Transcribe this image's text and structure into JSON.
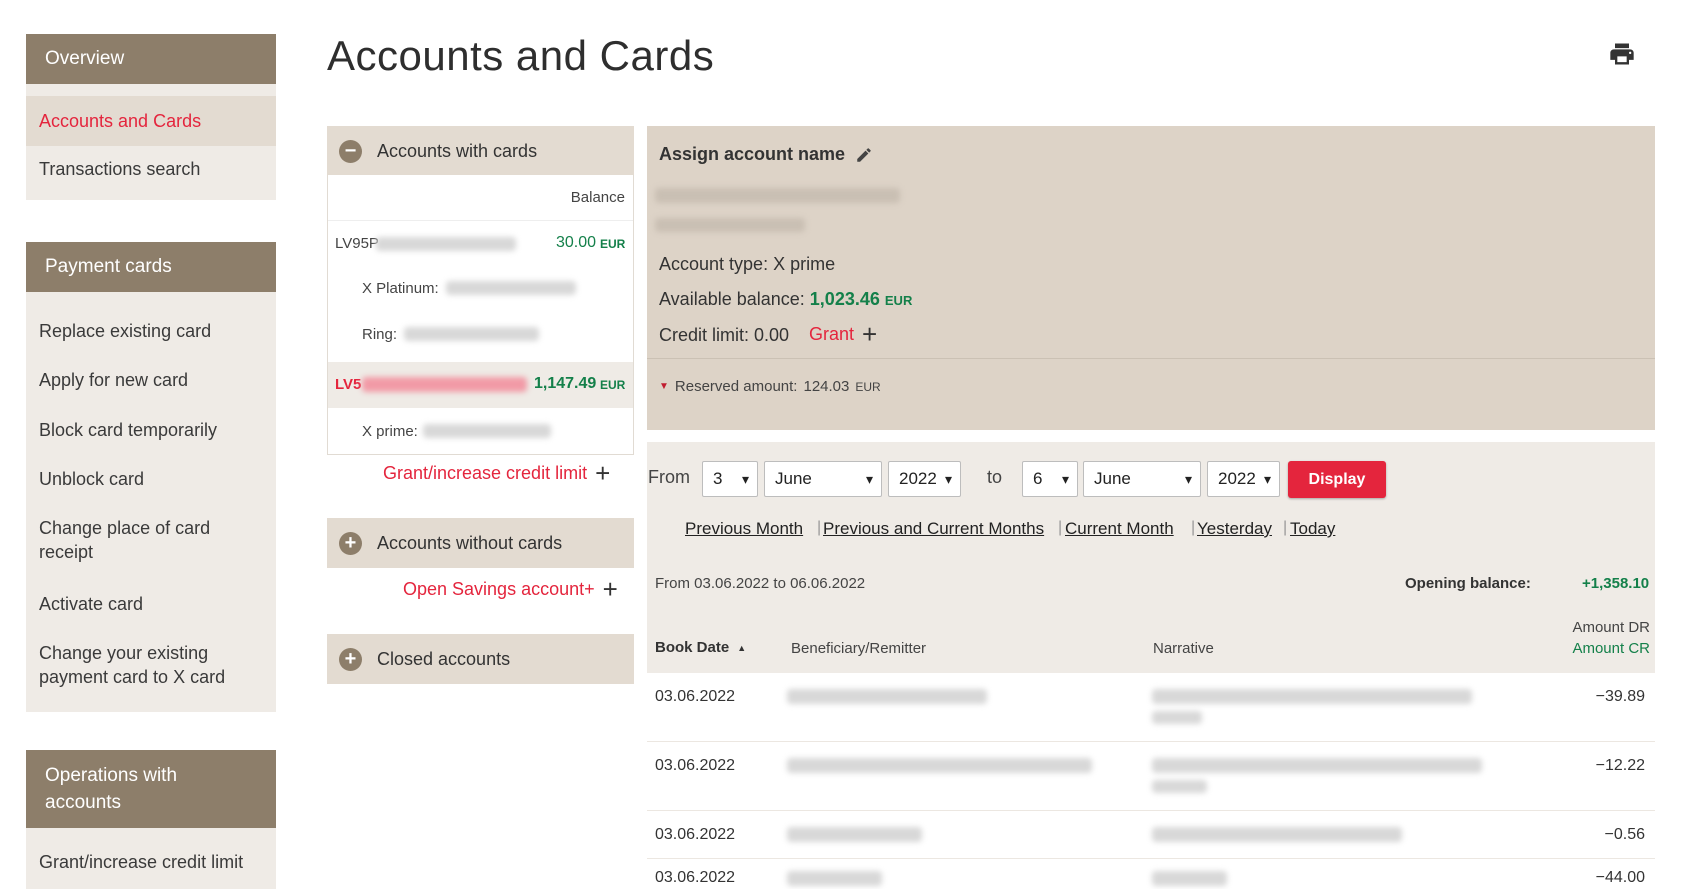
{
  "sidebar": {
    "overview": {
      "title": "Overview",
      "items": [
        "Accounts and Cards",
        "Transactions search"
      ]
    },
    "payment_cards": {
      "title": "Payment cards",
      "items": [
        "Replace existing card",
        "Apply for new card",
        "Block card temporarily",
        "Unblock card",
        "Change place of card receipt",
        "Activate card",
        "Change your existing payment card to X card"
      ]
    },
    "operations": {
      "title": "Operations with accounts",
      "items": [
        "Grant/increase credit limit"
      ]
    }
  },
  "page_title": "Accounts and Cards",
  "accounts_with_cards": {
    "title": "Accounts with cards",
    "balance_header": "Balance",
    "accounts": [
      {
        "iban_prefix": "LV95P",
        "balance": "30.00",
        "currency": "EUR",
        "cards": [
          {
            "label": "X Platinum:"
          },
          {
            "label": "Ring:"
          }
        ]
      },
      {
        "iban_prefix": "LV5",
        "balance": "1,147.49",
        "currency": "EUR",
        "cards": [
          {
            "label": "X prime:"
          }
        ]
      }
    ],
    "credit_link": "Grant/increase credit limit"
  },
  "accounts_without_cards": {
    "title": "Accounts without cards",
    "link": "Open Savings account+"
  },
  "closed_accounts": {
    "title": "Closed accounts"
  },
  "account_details": {
    "assign_name": "Assign account name",
    "account_type": "Account type: X prime",
    "available_label": "Available balance:",
    "available_value": "1,023.46",
    "available_currency": "EUR",
    "credit_limit": "Credit limit: 0.00",
    "grant_label": "Grant",
    "reserved_label": "Reserved amount:",
    "reserved_value": "124.03",
    "reserved_currency": "EUR"
  },
  "filter": {
    "from_label": "From",
    "to_label": "to",
    "from_day": "3",
    "from_month": "June",
    "from_year": "2022",
    "to_day": "6",
    "to_month": "June",
    "to_year": "2022",
    "display_button": "Display",
    "quick_links": [
      "Previous Month",
      "Previous and Current Months",
      "Current Month",
      "Yesterday",
      "Today"
    ]
  },
  "transactions": {
    "period": "From 03.06.2022 to 06.06.2022",
    "opening_label": "Opening balance:",
    "opening_value": "+1,358.10",
    "columns": {
      "book_date": "Book Date",
      "beneficiary": "Beneficiary/Remitter",
      "narrative": "Narrative",
      "amount_dr": "Amount DR",
      "amount_cr": "Amount CR"
    },
    "rows": [
      {
        "date": "03.06.2022",
        "amount": "−39.89"
      },
      {
        "date": "03.06.2022",
        "amount": "−12.22"
      },
      {
        "date": "03.06.2022",
        "amount": "−0.56"
      },
      {
        "date": "03.06.2022",
        "amount": "−44.00"
      }
    ]
  },
  "colors": {
    "accent_red": "#e4253d",
    "sidebar_head": "#8d7e6a",
    "green": "#14804a"
  }
}
